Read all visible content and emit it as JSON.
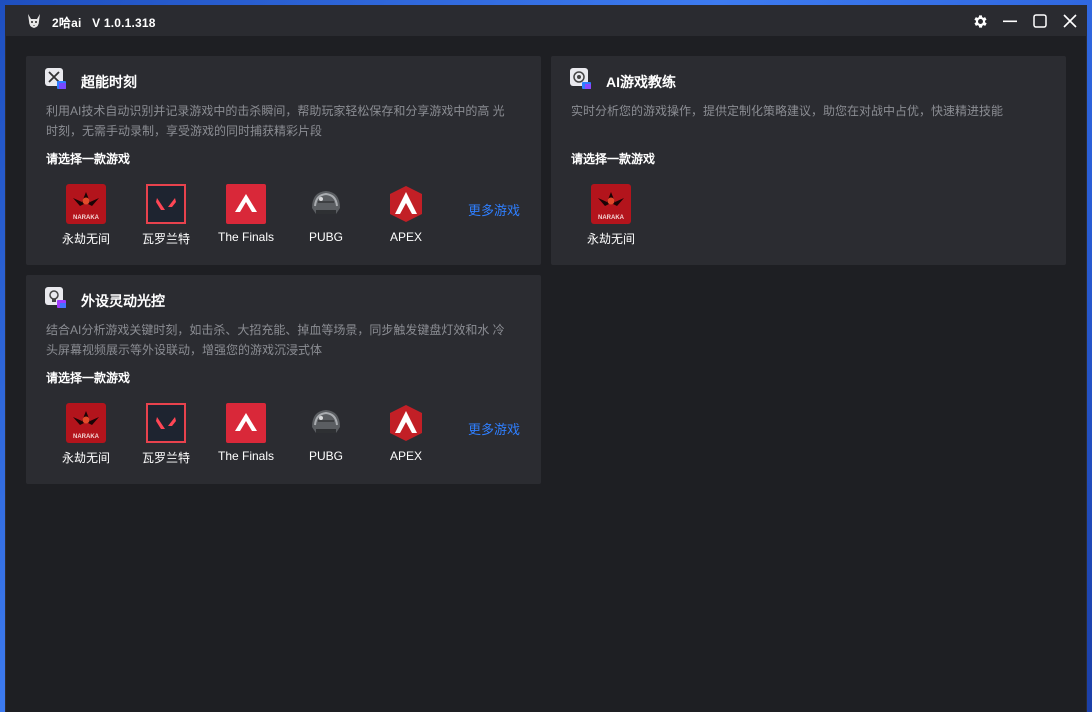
{
  "app": {
    "title": "2哈ai",
    "version": "V 1.0.1.318"
  },
  "cards": {
    "highlight": {
      "title": "超能时刻",
      "desc_line1": "利用AI技术自动识别并记录游戏中的击杀瞬间，帮助玩家轻松保存和分享游戏中的高 光",
      "desc_line2": "时刻，无需手动录制，享受游戏的同时捕获精彩片段",
      "select_label": "请选择一款游戏",
      "games": [
        "永劫无间",
        "瓦罗兰特",
        "The Finals",
        "PUBG",
        "APEX"
      ],
      "more": "更多游戏"
    },
    "coach": {
      "title": "AI游戏教练",
      "desc_line1": "实时分析您的游戏操作，提供定制化策略建议，助您在对战中占优，快速精进技能",
      "select_label": "请选择一款游戏",
      "games": [
        "永劫无间"
      ]
    },
    "lighting": {
      "title": "外设灵动光控",
      "desc_line1": "结合AI分析游戏关键时刻，如击杀、大招充能、掉血等场景，同步触发键盘灯效和水 冷",
      "desc_line2": "头屏幕视频展示等外设联动，增强您的游戏沉浸式体",
      "select_label": "请选择一款游戏",
      "games": [
        "永劫无间",
        "瓦罗兰特",
        "The Finals",
        "PUBG",
        "APEX"
      ],
      "more": "更多游戏"
    }
  },
  "icons": {
    "app_logo": "husky-logo-icon",
    "settings": "gear-icon",
    "minimize": "minimize-icon",
    "maximize": "maximize-icon",
    "close": "close-icon",
    "naraka_logo_text": "NARAKA"
  },
  "colors": {
    "accent": "#2f7fff",
    "card_bg": "#2b2c31",
    "window_bg": "#1e1f23"
  }
}
